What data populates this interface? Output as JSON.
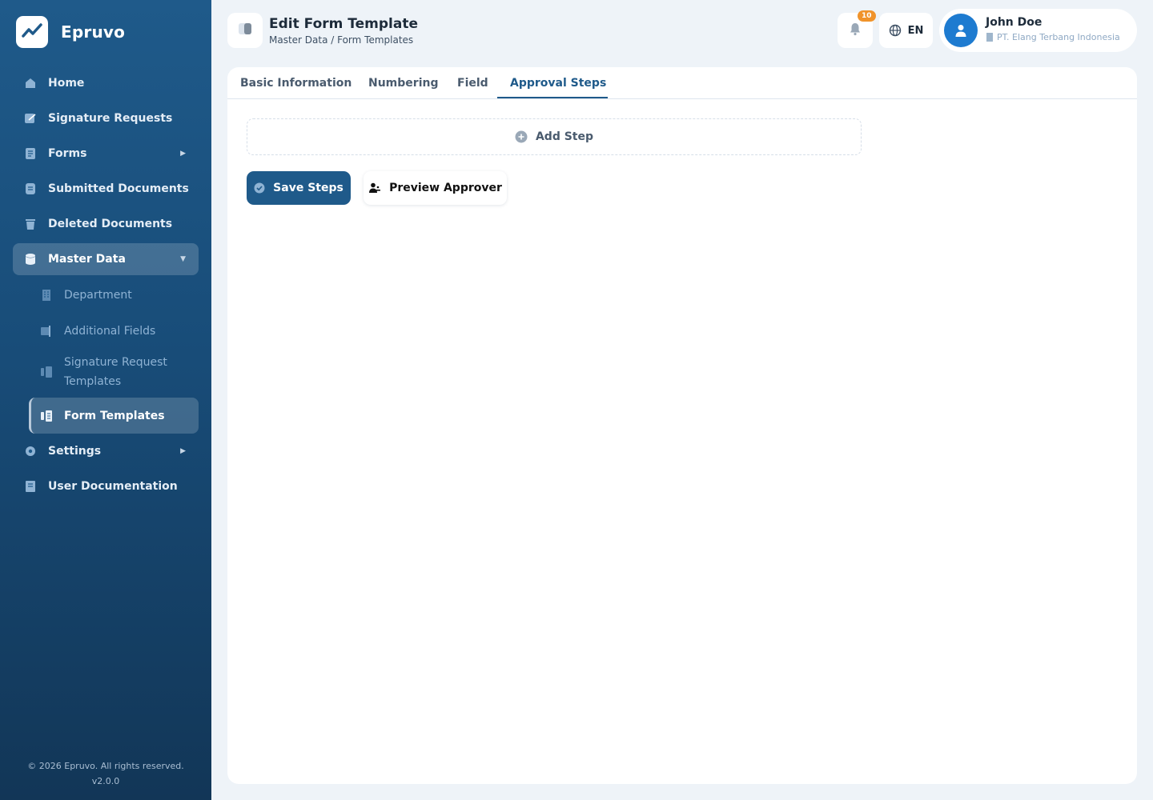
{
  "brand": {
    "name": "Epruvo"
  },
  "sidebar": {
    "items": [
      {
        "label": "Home",
        "icon": "home-icon"
      },
      {
        "label": "Signature Requests",
        "icon": "signature-icon"
      },
      {
        "label": "Forms",
        "icon": "forms-icon"
      },
      {
        "label": "Submitted Documents",
        "icon": "document-icon"
      },
      {
        "label": "Deleted Documents",
        "icon": "trash-icon"
      },
      {
        "label": "Master Data",
        "icon": "database-icon"
      },
      {
        "label": "Settings",
        "icon": "gear-icon"
      },
      {
        "label": "User Documentation",
        "icon": "book-icon"
      }
    ],
    "master_data_sub": [
      {
        "label": "Department",
        "icon": "building-icon"
      },
      {
        "label": "Additional Fields",
        "icon": "fields-icon"
      },
      {
        "label": "Signature Request Templates",
        "icon": "template-icon"
      },
      {
        "label": "Form Templates",
        "icon": "template-icon"
      }
    ],
    "footer": {
      "copyright": "© 2026 Epruvo. All rights reserved.",
      "version": "v2.0.0"
    }
  },
  "header": {
    "title": "Edit Form Template",
    "breadcrumb": "Master Data / Form Templates",
    "notifications_count": "10",
    "language": "EN",
    "user": {
      "name": "John Doe",
      "company": "PT. Elang Terbang Indonesia"
    }
  },
  "tabs": [
    {
      "label": "Basic Information",
      "active": false
    },
    {
      "label": "Numbering",
      "active": false
    },
    {
      "label": "Field",
      "active": false
    },
    {
      "label": "Approval Steps",
      "active": true
    }
  ],
  "approval": {
    "add_step_label": "Add Step",
    "save_label": "Save Steps",
    "preview_label": "Preview Approver"
  },
  "colors": {
    "primary": "#1f5a8a",
    "badge": "#f0932b",
    "avatar": "#1e7bd0"
  }
}
